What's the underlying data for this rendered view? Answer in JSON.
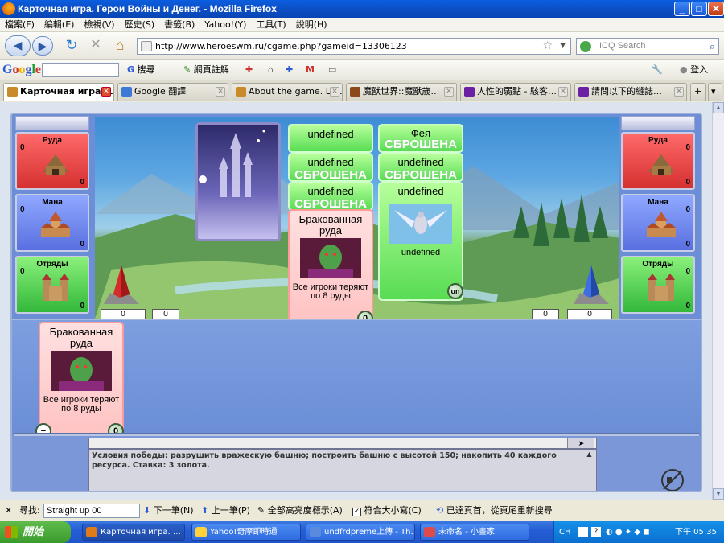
{
  "window": {
    "title": "Карточная игра. Герои Войны и Денег. - Mozilla Firefox",
    "min": "_",
    "max": "□",
    "close": "✕"
  },
  "menu": [
    "檔案(F)",
    "編輯(E)",
    "檢視(V)",
    "歷史(S)",
    "書籤(B)",
    "Yahoo!(Y)",
    "工具(T)",
    "說明(H)"
  ],
  "nav": {
    "back": "◀",
    "fwd": "▶",
    "reload": "↻",
    "stop": "✕",
    "home": "⌂",
    "url": "http://www.heroeswm.ru/cgame.php?gameid=13306123",
    "search_placeholder": "ICQ Search"
  },
  "gtoolbar": {
    "logo": [
      "G",
      "o",
      "o",
      "g",
      "l",
      "e"
    ],
    "search_btn": "搜尋",
    "translate": "網頁註解",
    "signin": "登入"
  },
  "tabs": [
    {
      "label": "Карточная игра.…",
      "color": "#c98a2a"
    },
    {
      "label": "Google 翻譯",
      "color": "#3d7ad8"
    },
    {
      "label": "About the game. Lor…",
      "color": "#c98a2a"
    },
    {
      "label": "魔獸世界::魔獸歲…",
      "color": "#8a4a1a"
    },
    {
      "label": "人性的弱點 - 駭客…",
      "color": "#6b1fa3"
    },
    {
      "label": "請問以下的縫誌…",
      "color": "#6b1fa3"
    }
  ],
  "game": {
    "left_resources": [
      {
        "label": "Руда",
        "count": "0",
        "income": "0"
      },
      {
        "label": "Мана",
        "count": "0",
        "income": "0"
      },
      {
        "label": "Отряды",
        "count": "0",
        "income": "0"
      }
    ],
    "right_resources": [
      {
        "label": "Руда",
        "count": "0",
        "income": "0"
      },
      {
        "label": "Мана",
        "count": "0",
        "income": "0"
      },
      {
        "label": "Отряды",
        "count": "0",
        "income": "0"
      }
    ],
    "left_tower": "0",
    "left_wall": "0",
    "right_wall": "0",
    "right_tower": "0",
    "played_col1": [
      {
        "title": "undefined",
        "stamp": ""
      },
      {
        "title": "undefined",
        "stamp": "СБРОШЕНА"
      },
      {
        "title": "undefined",
        "stamp": "СБРОШЕНА"
      }
    ],
    "played_col2": [
      {
        "title": "Фея",
        "stamp": "СБРОШЕНА"
      },
      {
        "title": "undefined",
        "stamp": "СБРОШЕНА"
      }
    ],
    "center_card": {
      "title": "Бракованная руда",
      "desc": "Все игроки теряют по 8 руды",
      "cost": "0"
    },
    "green_card": {
      "title": "undefined",
      "desc": "undefined",
      "cost": "un"
    },
    "hand_card": {
      "title": "Бракованная руда",
      "desc": "Все игроки теряют по 8 руды",
      "cost": "0",
      "minus": "−"
    },
    "log": "Условия победы: разрушить вражескую башню; построить башню с высотой 150; накопить 40 каждого ресурса. Ставка: 3 золота."
  },
  "findbar": {
    "close": "✕",
    "label": "尋找:",
    "value": "Straight up 00",
    "next": "下一筆(N)",
    "prev": "上一筆(P)",
    "highlight": "全部高亮度標示(A)",
    "match_case": "符合大小寫(C)",
    "status": "已達頁首，從頁尾重新搜尋"
  },
  "taskbar": {
    "start": "開始",
    "tasks": [
      {
        "label": "Карточная игра. …",
        "color": "#e07b1a"
      },
      {
        "label": "Yahoo!奇摩即時通",
        "color": "#ffd23a"
      },
      {
        "label": "undfrdpreme上傳 - Th…",
        "color": "#5a8ae0"
      },
      {
        "label": "未命名 - 小畫家",
        "color": "#e04a4a"
      }
    ],
    "lang": "CH",
    "time": "下午 05:35"
  }
}
